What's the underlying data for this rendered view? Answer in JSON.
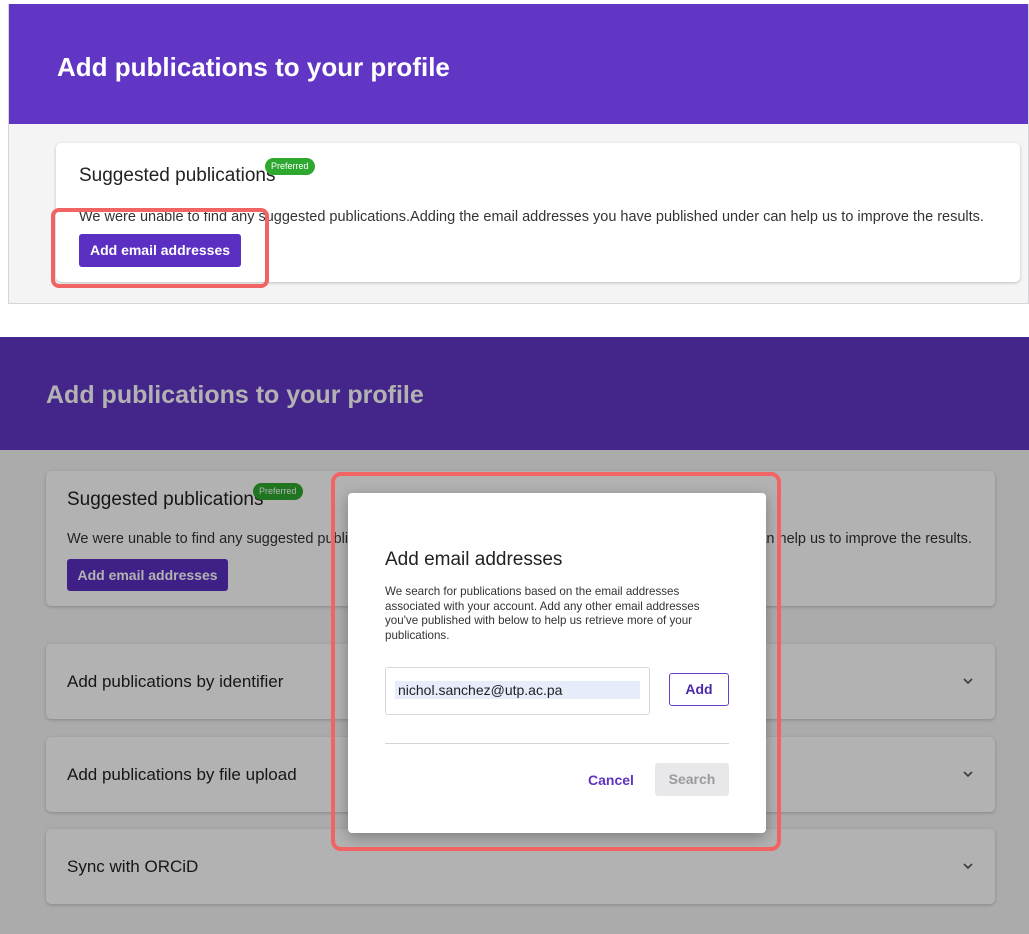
{
  "top": {
    "header_title": "Add publications to your profile",
    "suggested": {
      "title": "Suggested publications",
      "badge": "Preferred",
      "message": "We were unable to find any suggested publications.Adding the email addresses you have published under can help us to improve the results.",
      "button_label": "Add email addresses"
    }
  },
  "bottom": {
    "header_title": "Add publications to your profile",
    "suggested": {
      "title": "Suggested publications",
      "badge": "Preferred",
      "message": "We were unable to find any suggested publications.Adding the email addresses you have published under can help us to improve the results.",
      "button_label": "Add email addresses"
    },
    "accordions": [
      {
        "label": "Add publications by identifier"
      },
      {
        "label": "Add publications by file upload"
      },
      {
        "label": "Sync with ORCiD"
      }
    ],
    "modal": {
      "title": "Add email addresses",
      "description": "We search for publications based on the email addresses associated with your account. Add any other email addresses you've published with below to help us retrieve more of your publications.",
      "email_value": "nichol.sanchez@utp.ac.pa",
      "add_label": "Add",
      "cancel_label": "Cancel",
      "search_label": "Search"
    }
  },
  "colors": {
    "header_purple": "#6236c4",
    "button_purple": "#5a2fc2",
    "badge_green": "#2fa82f",
    "highlight_red": "#f26363"
  },
  "icons": {
    "accordion_toggle": "chevron-down-icon"
  }
}
